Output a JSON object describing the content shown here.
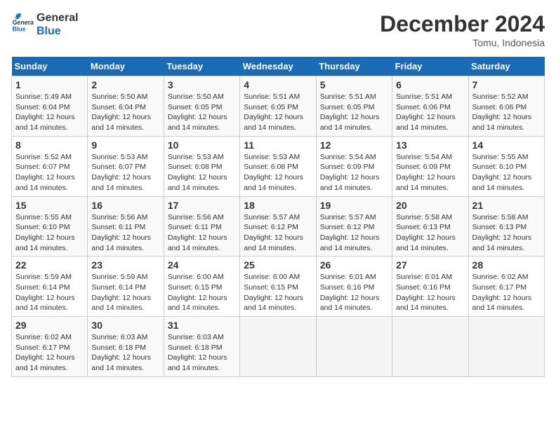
{
  "header": {
    "logo_line1": "General",
    "logo_line2": "Blue",
    "month_title": "December 2024",
    "location": "Tomu, Indonesia"
  },
  "calendar": {
    "days_of_week": [
      "Sunday",
      "Monday",
      "Tuesday",
      "Wednesday",
      "Thursday",
      "Friday",
      "Saturday"
    ],
    "weeks": [
      [
        {
          "day": "1",
          "info": "Sunrise: 5:49 AM\nSunset: 6:04 PM\nDaylight: 12 hours\nand 14 minutes."
        },
        {
          "day": "2",
          "info": "Sunrise: 5:50 AM\nSunset: 6:04 PM\nDaylight: 12 hours\nand 14 minutes."
        },
        {
          "day": "3",
          "info": "Sunrise: 5:50 AM\nSunset: 6:05 PM\nDaylight: 12 hours\nand 14 minutes."
        },
        {
          "day": "4",
          "info": "Sunrise: 5:51 AM\nSunset: 6:05 PM\nDaylight: 12 hours\nand 14 minutes."
        },
        {
          "day": "5",
          "info": "Sunrise: 5:51 AM\nSunset: 6:05 PM\nDaylight: 12 hours\nand 14 minutes."
        },
        {
          "day": "6",
          "info": "Sunrise: 5:51 AM\nSunset: 6:06 PM\nDaylight: 12 hours\nand 14 minutes."
        },
        {
          "day": "7",
          "info": "Sunrise: 5:52 AM\nSunset: 6:06 PM\nDaylight: 12 hours\nand 14 minutes."
        }
      ],
      [
        {
          "day": "8",
          "info": "Sunrise: 5:52 AM\nSunset: 6:07 PM\nDaylight: 12 hours\nand 14 minutes."
        },
        {
          "day": "9",
          "info": "Sunrise: 5:53 AM\nSunset: 6:07 PM\nDaylight: 12 hours\nand 14 minutes."
        },
        {
          "day": "10",
          "info": "Sunrise: 5:53 AM\nSunset: 6:08 PM\nDaylight: 12 hours\nand 14 minutes."
        },
        {
          "day": "11",
          "info": "Sunrise: 5:53 AM\nSunset: 6:08 PM\nDaylight: 12 hours\nand 14 minutes."
        },
        {
          "day": "12",
          "info": "Sunrise: 5:54 AM\nSunset: 6:09 PM\nDaylight: 12 hours\nand 14 minutes."
        },
        {
          "day": "13",
          "info": "Sunrise: 5:54 AM\nSunset: 6:09 PM\nDaylight: 12 hours\nand 14 minutes."
        },
        {
          "day": "14",
          "info": "Sunrise: 5:55 AM\nSunset: 6:10 PM\nDaylight: 12 hours\nand 14 minutes."
        }
      ],
      [
        {
          "day": "15",
          "info": "Sunrise: 5:55 AM\nSunset: 6:10 PM\nDaylight: 12 hours\nand 14 minutes."
        },
        {
          "day": "16",
          "info": "Sunrise: 5:56 AM\nSunset: 6:11 PM\nDaylight: 12 hours\nand 14 minutes."
        },
        {
          "day": "17",
          "info": "Sunrise: 5:56 AM\nSunset: 6:11 PM\nDaylight: 12 hours\nand 14 minutes."
        },
        {
          "day": "18",
          "info": "Sunrise: 5:57 AM\nSunset: 6:12 PM\nDaylight: 12 hours\nand 14 minutes."
        },
        {
          "day": "19",
          "info": "Sunrise: 5:57 AM\nSunset: 6:12 PM\nDaylight: 12 hours\nand 14 minutes."
        },
        {
          "day": "20",
          "info": "Sunrise: 5:58 AM\nSunset: 6:13 PM\nDaylight: 12 hours\nand 14 minutes."
        },
        {
          "day": "21",
          "info": "Sunrise: 5:58 AM\nSunset: 6:13 PM\nDaylight: 12 hours\nand 14 minutes."
        }
      ],
      [
        {
          "day": "22",
          "info": "Sunrise: 5:59 AM\nSunset: 6:14 PM\nDaylight: 12 hours\nand 14 minutes."
        },
        {
          "day": "23",
          "info": "Sunrise: 5:59 AM\nSunset: 6:14 PM\nDaylight: 12 hours\nand 14 minutes."
        },
        {
          "day": "24",
          "info": "Sunrise: 6:00 AM\nSunset: 6:15 PM\nDaylight: 12 hours\nand 14 minutes."
        },
        {
          "day": "25",
          "info": "Sunrise: 6:00 AM\nSunset: 6:15 PM\nDaylight: 12 hours\nand 14 minutes."
        },
        {
          "day": "26",
          "info": "Sunrise: 6:01 AM\nSunset: 6:16 PM\nDaylight: 12 hours\nand 14 minutes."
        },
        {
          "day": "27",
          "info": "Sunrise: 6:01 AM\nSunset: 6:16 PM\nDaylight: 12 hours\nand 14 minutes."
        },
        {
          "day": "28",
          "info": "Sunrise: 6:02 AM\nSunset: 6:17 PM\nDaylight: 12 hours\nand 14 minutes."
        }
      ],
      [
        {
          "day": "29",
          "info": "Sunrise: 6:02 AM\nSunset: 6:17 PM\nDaylight: 12 hours\nand 14 minutes."
        },
        {
          "day": "30",
          "info": "Sunrise: 6:03 AM\nSunset: 6:18 PM\nDaylight: 12 hours\nand 14 minutes."
        },
        {
          "day": "31",
          "info": "Sunrise: 6:03 AM\nSunset: 6:18 PM\nDaylight: 12 hours\nand 14 minutes."
        },
        {
          "day": "",
          "info": ""
        },
        {
          "day": "",
          "info": ""
        },
        {
          "day": "",
          "info": ""
        },
        {
          "day": "",
          "info": ""
        }
      ]
    ]
  }
}
